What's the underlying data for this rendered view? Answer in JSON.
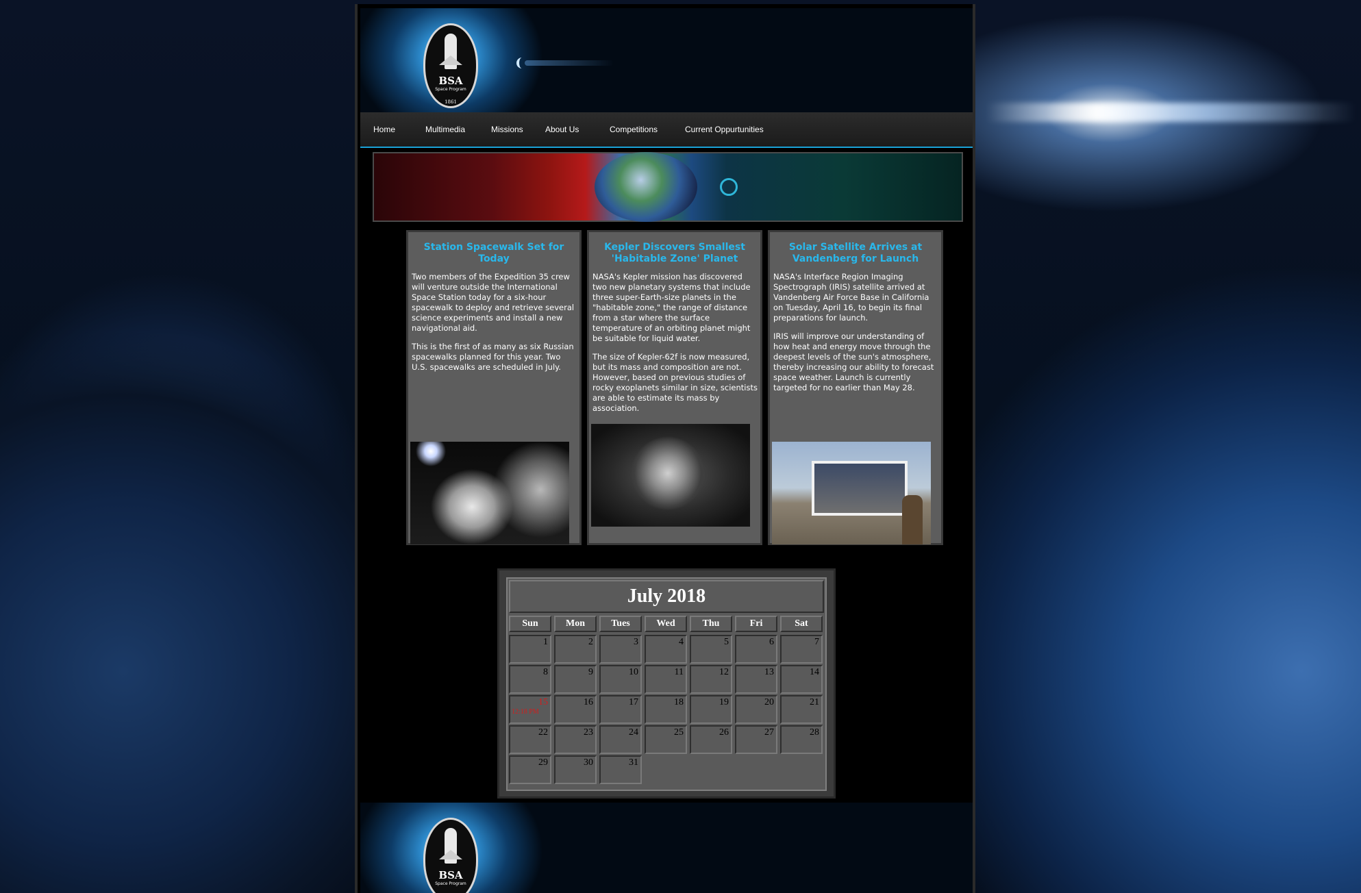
{
  "site": {
    "logo": {
      "name": "BSA",
      "subtitle": "Space Program",
      "year": "1861"
    }
  },
  "nav": {
    "items": [
      {
        "label": "Home"
      },
      {
        "label": "Multimedia"
      },
      {
        "label": "Missions"
      },
      {
        "label": "About Us"
      },
      {
        "label": "Competitions"
      },
      {
        "label": "Current Oppurtunities"
      }
    ]
  },
  "articles": [
    {
      "title": "Station Spacewalk Set for Today",
      "paragraphs": [
        "Two members of the Expedition 35 crew will venture outside the International Space Station today for a six-hour spacewalk to deploy and retrieve several science experiments and install a new navigational aid.",
        "This is the first of as many as six Russian spacewalks planned for this year. Two U.S. spacewalks are scheduled in July."
      ],
      "image": "astronaut-spacewalk-photo"
    },
    {
      "title": "Kepler Discovers Smallest 'Habitable Zone' Planet",
      "paragraphs": [
        "NASA's Kepler mission has discovered two new planetary systems that include three super-Earth-size planets in the \"habitable zone,\" the range of distance from a star where the surface temperature of an orbiting planet might be suitable for liquid water.",
        "The size of Kepler-62f is now measured, but its mass and composition are not. However, based on previous studies of rocky exoplanets similar in size, scientists are able to estimate its mass by association."
      ],
      "image": "exoplanet-render"
    },
    {
      "title": "Solar Satellite Arrives at Vandenberg for Launch",
      "paragraphs": [
        "NASA's Interface Region Imaging Spectrograph (IRIS) satellite arrived at Vandenberg Air Force Base in California on Tuesday, April 16, to begin its final preparations for launch.",
        "IRIS will improve our understanding of how heat and energy move through the deepest levels of the sun's atmosphere, thereby increasing our ability to forecast space weather. Launch is currently targeted for no earlier than May 28."
      ],
      "image": "satellite-transport-photo"
    }
  ],
  "calendar": {
    "title": "July 2018",
    "weekdays": [
      "Sun",
      "Mon",
      "Tues",
      "Wed",
      "Thu",
      "Fri",
      "Sat"
    ],
    "weeks": [
      [
        "1",
        "2",
        "3",
        "4",
        "5",
        "6",
        "7"
      ],
      [
        "8",
        "9",
        "10",
        "11",
        "12",
        "13",
        "14"
      ],
      [
        "15",
        "16",
        "17",
        "18",
        "19",
        "20",
        "21"
      ],
      [
        "22",
        "23",
        "24",
        "25",
        "26",
        "27",
        "28"
      ],
      [
        "29",
        "30",
        "31"
      ]
    ],
    "highlight": {
      "day": "15",
      "note": "12:18 PM",
      "color": "#d11e1e"
    }
  },
  "colors": {
    "accent": "#29b8ec",
    "nav_border": "#1aa3d9",
    "card_bg": "#5d5d5d"
  }
}
